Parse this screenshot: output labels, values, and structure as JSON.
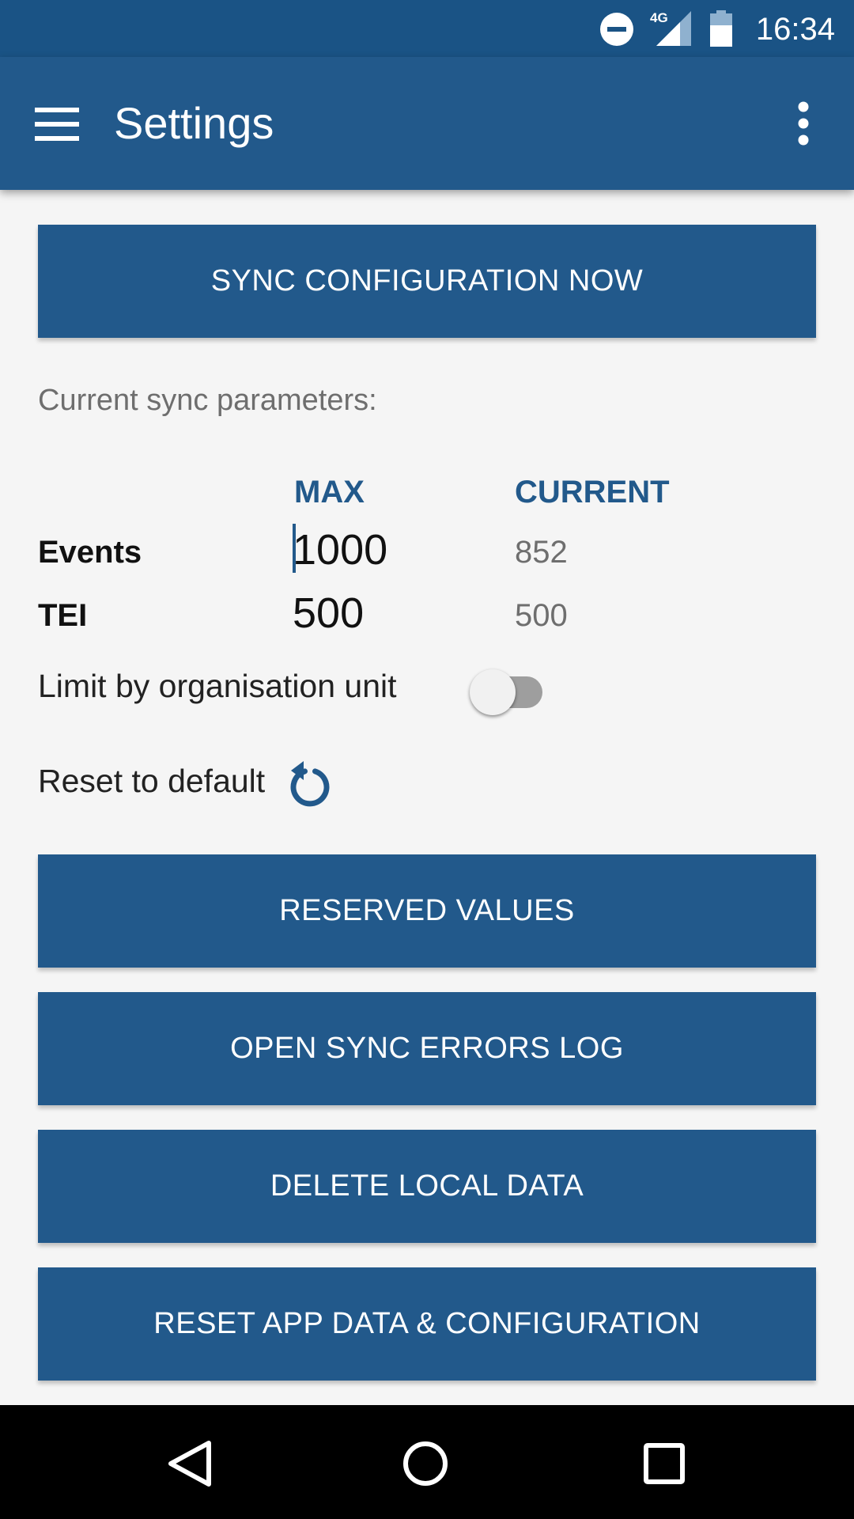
{
  "status_bar": {
    "time": "16:34",
    "network_label": "4G",
    "icons": [
      "do-not-disturb-icon",
      "signal-icon",
      "battery-icon"
    ]
  },
  "app_bar": {
    "title": "Settings",
    "icons": [
      "menu-icon",
      "more-vert-icon"
    ]
  },
  "sync": {
    "sync_now_label": "SYNC CONFIGURATION NOW",
    "params_label": "Current sync parameters:",
    "col_max": "MAX",
    "col_current": "CURRENT",
    "rows": [
      {
        "label": "Events",
        "max": "1000",
        "current": "852"
      },
      {
        "label": "TEI",
        "max": "500",
        "current": "500"
      }
    ],
    "limit_label": "Limit by organisation unit",
    "limit_enabled": false,
    "reset_label": "Reset to default"
  },
  "buttons": {
    "reserved_values": "RESERVED VALUES",
    "sync_errors_log": "OPEN SYNC ERRORS LOG",
    "delete_local_data": "DELETE LOCAL DATA",
    "reset_app": "RESET APP DATA & CONFIGURATION"
  },
  "colors": {
    "primary": "#22598b",
    "status_bar": "#1a5385",
    "background": "#f5f5f5"
  }
}
